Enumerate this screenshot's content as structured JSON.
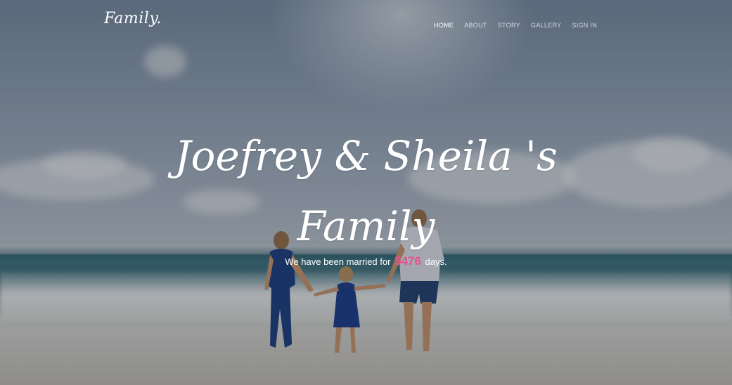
{
  "brand": {
    "logo": "Family."
  },
  "nav": {
    "items": [
      {
        "label": "HOME",
        "active": true
      },
      {
        "label": "ABOUT",
        "active": false
      },
      {
        "label": "STORY",
        "active": false
      },
      {
        "label": "GALLERY",
        "active": false
      },
      {
        "label": "SIGN IN",
        "active": false
      }
    ]
  },
  "hero": {
    "title_line1": "Joefrey & Sheila 's",
    "title_line2": "Family",
    "subtitle_before": "We have been married for",
    "days_count": "5476",
    "subtitle_after": "days.",
    "accent_color": "#e84f8f"
  }
}
